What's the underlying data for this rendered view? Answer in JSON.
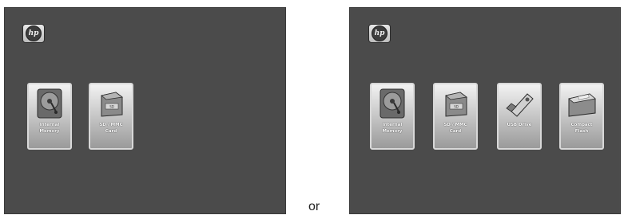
{
  "left_screen": {
    "logo": {
      "text": "hp",
      "icon": "hp-logo-icon"
    },
    "tiles": [
      {
        "label": "Internal\nMemory",
        "icon": "hard-drive-icon"
      },
      {
        "label": "SD / MMC\nCard",
        "icon": "sd-card-icon"
      }
    ]
  },
  "separator": {
    "text": "or"
  },
  "right_screen": {
    "logo": {
      "text": "hp",
      "icon": "hp-logo-icon"
    },
    "tiles": [
      {
        "label": "Internal\nMemory",
        "icon": "hard-drive-icon"
      },
      {
        "label": "SD / MMC\nCard",
        "icon": "sd-card-icon"
      },
      {
        "label": "USB Drive",
        "icon": "usb-drive-icon"
      },
      {
        "label": "Compact\nFlash",
        "icon": "compact-flash-icon"
      }
    ]
  },
  "colors": {
    "screen_background": "#4b4b4b",
    "tile_border": "#d8d8d8",
    "label_text": "#ffffff"
  }
}
